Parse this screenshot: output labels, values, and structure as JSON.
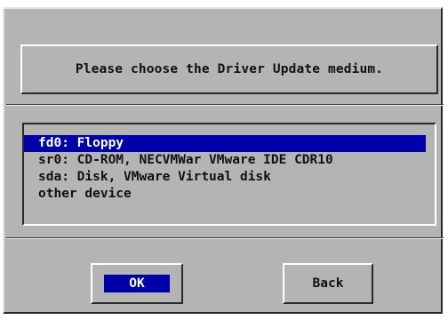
{
  "dialog": {
    "title": "Please choose the Driver Update medium.",
    "list": {
      "items": [
        {
          "label": "fd0: Floppy",
          "selected": true
        },
        {
          "label": "sr0: CD-ROM, NECVMWar VMware IDE CDR10",
          "selected": false
        },
        {
          "label": "sda: Disk, VMware Virtual disk",
          "selected": false
        },
        {
          "label": "other device",
          "selected": false
        }
      ]
    },
    "buttons": {
      "ok_label": "OK",
      "back_label": "Back"
    },
    "colors": {
      "background": "#b4b4b4",
      "selection": "#0000a8",
      "selection_text": "#ffffff"
    }
  }
}
